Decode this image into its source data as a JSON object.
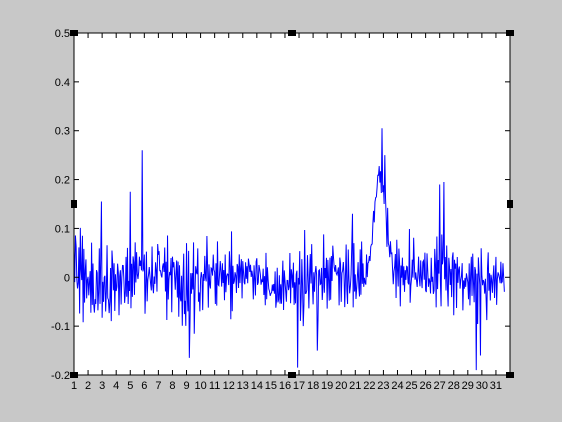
{
  "figure": {
    "background_color": "#c8c8c8",
    "axes_background_color": "#ffffff",
    "line_color": "#0000ff",
    "selection_handles": true
  },
  "chart_data": {
    "type": "line",
    "title": "",
    "xlabel": "",
    "ylabel": "",
    "xlim": [
      1,
      32
    ],
    "ylim": [
      -0.2,
      0.5
    ],
    "grid": false,
    "legend": "none",
    "x_tick_labels": [
      "1",
      "2",
      "3",
      "4",
      "5",
      "6",
      "7",
      "8",
      "9",
      "10",
      "11",
      "12",
      "13",
      "14",
      "15",
      "16",
      "17",
      "18",
      "19",
      "20",
      "21",
      "22",
      "23",
      "24",
      "25",
      "26",
      "27",
      "28",
      "29",
      "30",
      "31"
    ],
    "y_tick_labels": [
      "-0.2",
      "-0.1",
      "0",
      "0.1",
      "0.2",
      "0.3",
      "0.4",
      "0.5"
    ],
    "y_ticks": [
      -0.2,
      -0.1,
      0,
      0.1,
      0.2,
      0.3,
      0.4,
      0.5
    ],
    "series": [
      {
        "points_per_unit": 20,
        "x_start": 1,
        "x_end": 31.6,
        "envelope": [
          {
            "x": 1.0,
            "y": 0.02,
            "amp": 0.15
          },
          {
            "x": 2.0,
            "y": -0.01,
            "amp": 0.16
          },
          {
            "x": 3.0,
            "y": -0.02,
            "amp": 0.15
          },
          {
            "x": 4.0,
            "y": -0.01,
            "amp": 0.14
          },
          {
            "x": 5.0,
            "y": 0.0,
            "amp": 0.13
          },
          {
            "x": 5.5,
            "y": 0.03,
            "amp": 0.13
          },
          {
            "x": 5.9,
            "y": 0.0,
            "amp": 0.16
          },
          {
            "x": 6.5,
            "y": 0.0,
            "amp": 0.1
          },
          {
            "x": 7.0,
            "y": 0.02,
            "amp": 0.12
          },
          {
            "x": 8.0,
            "y": 0.0,
            "amp": 0.16
          },
          {
            "x": 9.0,
            "y": -0.02,
            "amp": 0.18
          },
          {
            "x": 10.0,
            "y": 0.0,
            "amp": 0.14
          },
          {
            "x": 11.0,
            "y": 0.01,
            "amp": 0.13
          },
          {
            "x": 12.0,
            "y": 0.0,
            "amp": 0.12
          },
          {
            "x": 13.0,
            "y": 0.0,
            "amp": 0.1
          },
          {
            "x": 14.0,
            "y": 0.01,
            "amp": 0.08
          },
          {
            "x": 15.0,
            "y": -0.03,
            "amp": 0.08
          },
          {
            "x": 16.0,
            "y": -0.01,
            "amp": 0.09
          },
          {
            "x": 17.0,
            "y": -0.02,
            "amp": 0.16
          },
          {
            "x": 18.0,
            "y": 0.0,
            "amp": 0.15
          },
          {
            "x": 19.0,
            "y": 0.01,
            "amp": 0.14
          },
          {
            "x": 20.0,
            "y": 0.01,
            "amp": 0.14
          },
          {
            "x": 21.0,
            "y": 0.0,
            "amp": 0.13
          },
          {
            "x": 21.7,
            "y": 0.0,
            "amp": 0.12
          },
          {
            "x": 22.0,
            "y": 0.04,
            "amp": 0.05
          },
          {
            "x": 22.4,
            "y": 0.14,
            "amp": 0.05
          },
          {
            "x": 22.7,
            "y": 0.22,
            "amp": 0.06
          },
          {
            "x": 23.0,
            "y": 0.18,
            "amp": 0.08
          },
          {
            "x": 23.5,
            "y": 0.05,
            "amp": 0.13
          },
          {
            "x": 24.0,
            "y": 0.01,
            "amp": 0.15
          },
          {
            "x": 25.0,
            "y": 0.0,
            "amp": 0.14
          },
          {
            "x": 26.0,
            "y": 0.0,
            "amp": 0.13
          },
          {
            "x": 27.0,
            "y": 0.01,
            "amp": 0.16
          },
          {
            "x": 28.0,
            "y": 0.0,
            "amp": 0.14
          },
          {
            "x": 29.0,
            "y": -0.01,
            "amp": 0.14
          },
          {
            "x": 30.0,
            "y": -0.02,
            "amp": 0.16
          },
          {
            "x": 31.0,
            "y": -0.01,
            "amp": 0.09
          },
          {
            "x": 31.6,
            "y": 0.0,
            "amp": 0.05
          }
        ],
        "spikes": [
          {
            "x": 5.85,
            "y": 0.26
          },
          {
            "x": 5.0,
            "y": 0.175
          },
          {
            "x": 2.95,
            "y": 0.155
          },
          {
            "x": 22.9,
            "y": 0.305
          },
          {
            "x": 23.1,
            "y": 0.25
          },
          {
            "x": 27.3,
            "y": 0.195
          },
          {
            "x": 27.0,
            "y": 0.19
          },
          {
            "x": 20.8,
            "y": 0.13
          },
          {
            "x": 16.9,
            "y": -0.185
          },
          {
            "x": 9.2,
            "y": -0.165
          },
          {
            "x": 29.6,
            "y": -0.19
          },
          {
            "x": 29.9,
            "y": -0.16
          },
          {
            "x": 18.3,
            "y": -0.15
          }
        ]
      }
    ]
  }
}
